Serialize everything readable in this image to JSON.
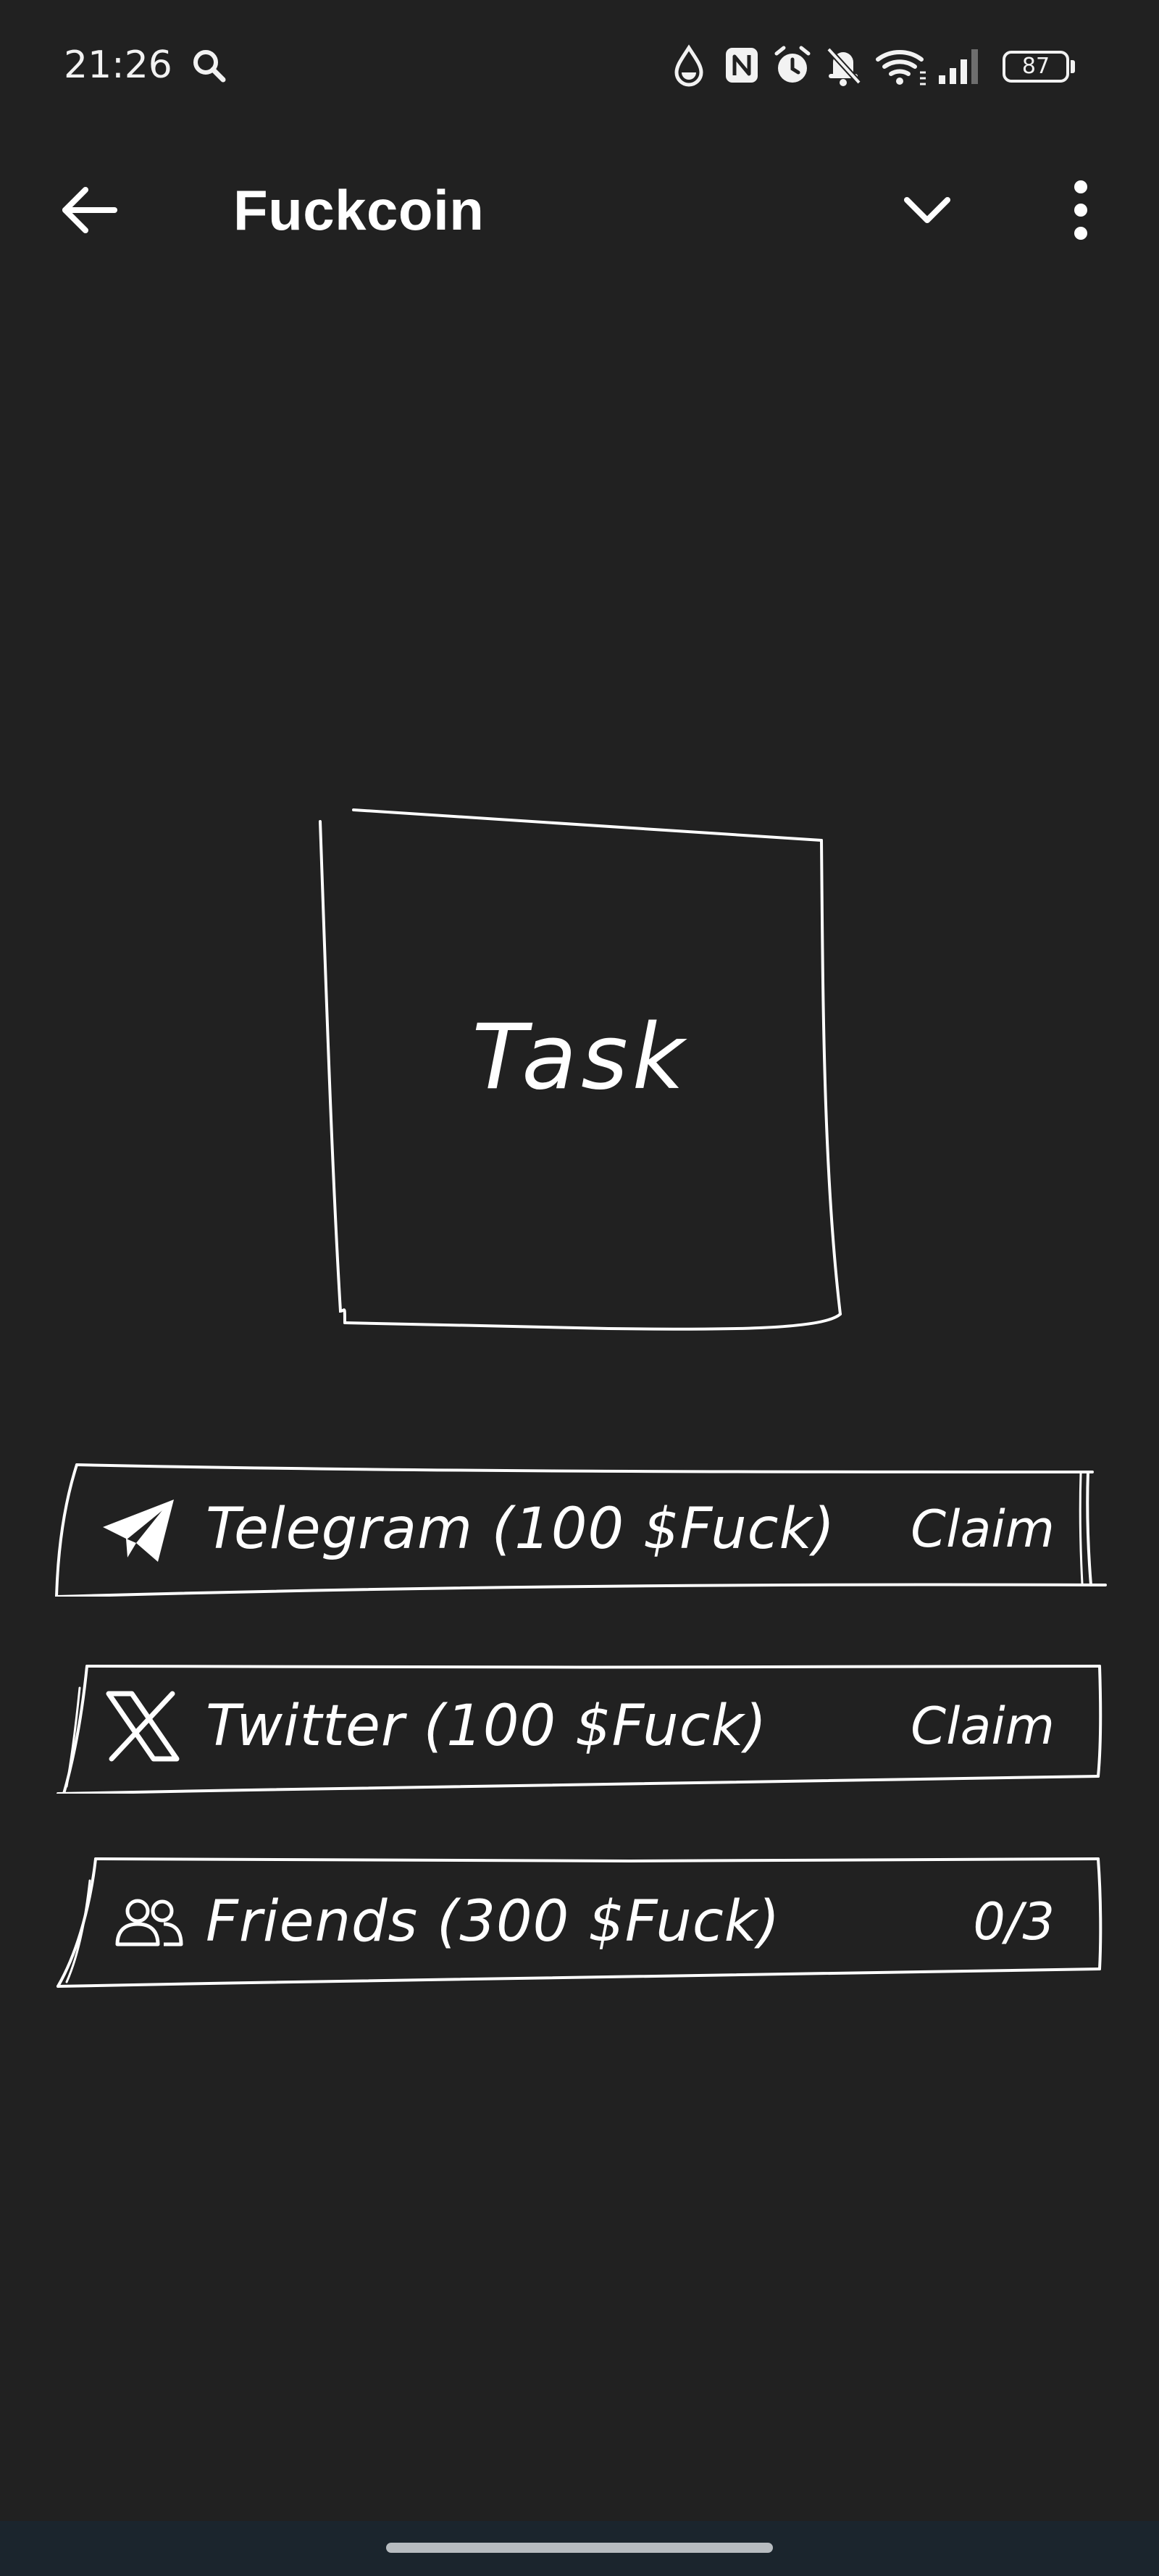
{
  "status_bar": {
    "time": "21:26",
    "battery_level": "87",
    "icons": [
      "search-icon",
      "water-drop-icon",
      "nfc-icon",
      "alarm-icon",
      "bell-off-icon",
      "wifi-icon",
      "signal-icon",
      "battery-icon"
    ]
  },
  "app_bar": {
    "title": "Fuckcoin",
    "back_icon": "arrow-left-icon",
    "collapse_icon": "chevron-down-icon",
    "menu_icon": "more-vertical-icon"
  },
  "task_box": {
    "label": "Task"
  },
  "tasks": [
    {
      "icon": "telegram-icon",
      "label": "Telegram (100 $Fuck)",
      "action": "Claim"
    },
    {
      "icon": "x-twitter-icon",
      "label": "Twitter (100 $Fuck)",
      "action": "Claim"
    },
    {
      "icon": "friends-icon",
      "label": "Friends (300 $Fuck)",
      "action": "0/3"
    }
  ],
  "colors": {
    "background": "#212121",
    "foreground": "#ffffff",
    "nav_bar": "#1b252d"
  }
}
